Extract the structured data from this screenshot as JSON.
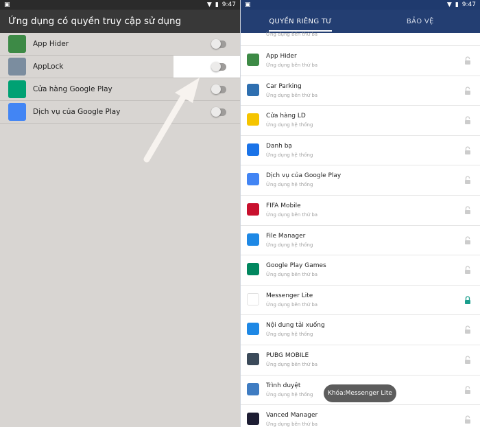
{
  "left": {
    "status_time": "9:47",
    "title": "Ứng dụng có quyền truy cập sử dụng",
    "apps": [
      {
        "name": "App Hider",
        "icon": "app-hider-icon",
        "color": "#3d8a46"
      },
      {
        "name": "AppLock",
        "icon": "applock-icon",
        "color": "#7b8d9f"
      },
      {
        "name": "Cửa hàng Google Play",
        "icon": "play-store-icon",
        "color": "#00a173"
      },
      {
        "name": "Dịch vụ của Google Play",
        "icon": "play-services-icon",
        "color": "#4285f4"
      }
    ]
  },
  "right": {
    "status_time": "9:47",
    "tabs": [
      "QUYỀN RIÊNG TƯ",
      "BẢO VỆ"
    ],
    "partial_sub": "Ứng dụng bên thứ ba",
    "apps": [
      {
        "name": "App Hider",
        "sub": "Ứng dụng bên thứ ba",
        "icon": "app-hider-icon",
        "color": "#3d8a46",
        "locked": false
      },
      {
        "name": "Car Parking",
        "sub": "Ứng dụng bên thứ ba",
        "icon": "car-parking-icon",
        "color": "#2e6fb0",
        "locked": false
      },
      {
        "name": "Cửa hàng LD",
        "sub": "Ứng dụng hệ thống",
        "icon": "ld-store-icon",
        "color": "#f5c400",
        "locked": false
      },
      {
        "name": "Danh bạ",
        "sub": "Ứng dụng hệ thống",
        "icon": "contacts-icon",
        "color": "#1a73e8",
        "locked": false
      },
      {
        "name": "Dịch vụ của Google Play",
        "sub": "Ứng dụng hệ thống",
        "icon": "play-services-icon",
        "color": "#4285f4",
        "locked": false
      },
      {
        "name": "FIFA Mobile",
        "sub": "Ứng dụng bên thứ ba",
        "icon": "fifa-icon",
        "color": "#c8102e",
        "locked": false
      },
      {
        "name": "File Manager",
        "sub": "Ứng dụng hệ thống",
        "icon": "file-manager-icon",
        "color": "#1e88e5",
        "locked": false
      },
      {
        "name": "Google Play Games",
        "sub": "Ứng dụng bên thứ ba",
        "icon": "play-games-icon",
        "color": "#01875f",
        "locked": false
      },
      {
        "name": "Messenger Lite",
        "sub": "Ứng dụng bên thứ ba",
        "icon": "messenger-icon",
        "color": "#ffffff",
        "locked": true
      },
      {
        "name": "Nội dung tải xuống",
        "sub": "Ứng dụng hệ thống",
        "icon": "downloads-icon",
        "color": "#1e88e5",
        "locked": false
      },
      {
        "name": "PUBG MOBILE",
        "sub": "Ứng dụng bên thứ ba",
        "icon": "pubg-icon",
        "color": "#3b4a5a",
        "locked": false
      },
      {
        "name": "Trình duyệt",
        "sub": "Ứng dụng hệ thống",
        "icon": "browser-icon",
        "color": "#3e7cc2",
        "locked": false
      },
      {
        "name": "Vanced Manager",
        "sub": "Ứng dụng bên thứ ba",
        "icon": "vanced-icon",
        "color": "#1d1d33",
        "locked": false
      }
    ],
    "toast": "Khóa:Messenger Lite",
    "lock_color_on": "#1a9e8c",
    "lock_color_off": "#cccccc"
  }
}
